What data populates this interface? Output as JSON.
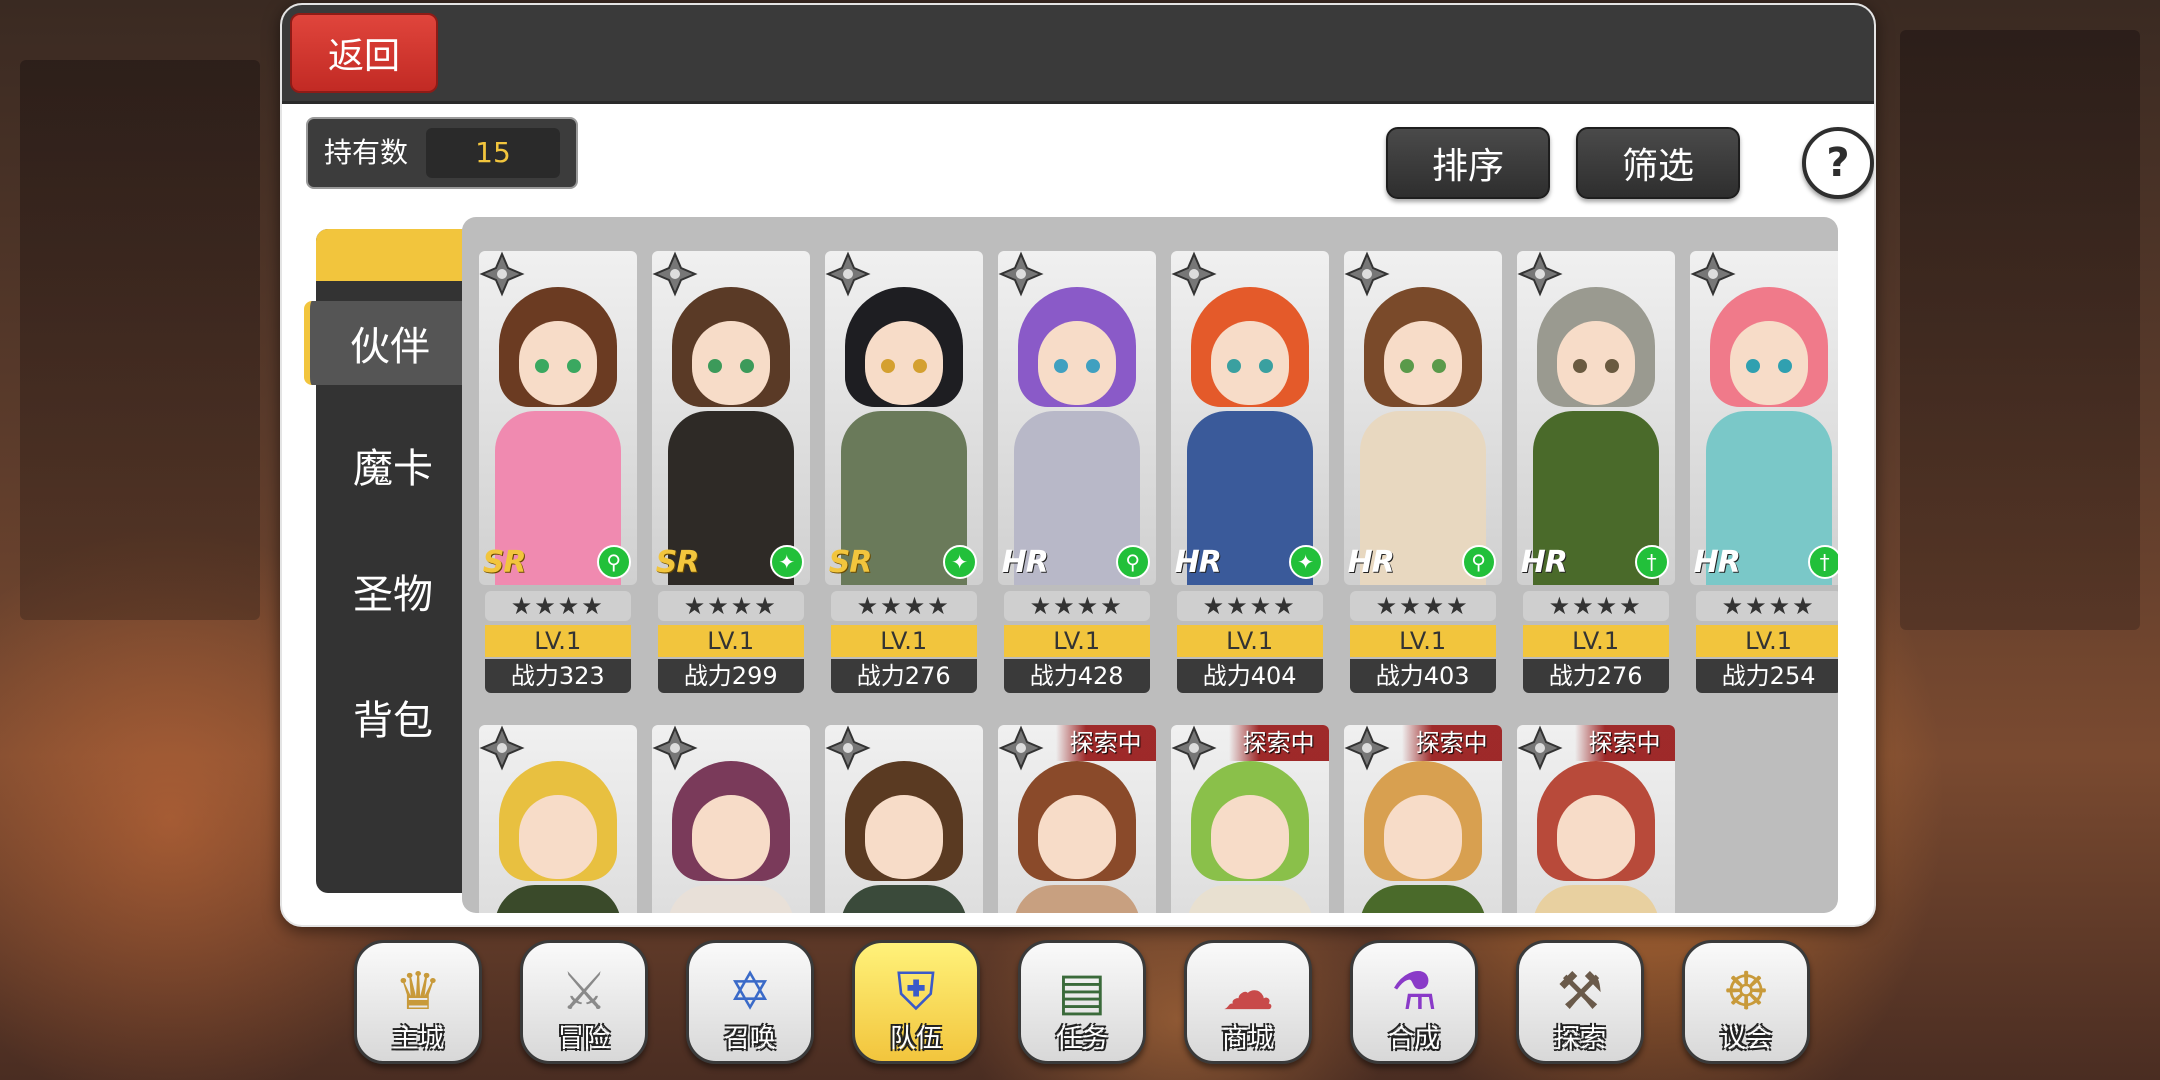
{
  "header": {
    "back_label": "返回"
  },
  "owned": {
    "label": "持有数",
    "value": "15"
  },
  "toolbar": {
    "sort_label": "排序",
    "filter_label": "筛选",
    "help_label": "?"
  },
  "sidebar": {
    "tabs": [
      {
        "label": "伙伴",
        "active": true
      },
      {
        "label": "魔卡",
        "active": false
      },
      {
        "label": "圣物",
        "active": false
      },
      {
        "label": "背包",
        "active": false
      }
    ]
  },
  "cards": [
    {
      "rarity": "SR",
      "stars": "★★★★",
      "level": "LV.1",
      "power": "战力323",
      "hair": "#6b3b22",
      "outfit": "#f08ab0",
      "eye": "#3aa860",
      "class_icon": "⚲"
    },
    {
      "rarity": "SR",
      "stars": "★★★★",
      "level": "LV.1",
      "power": "战力299",
      "hair": "#5a3a26",
      "outfit": "#2e2a26",
      "eye": "#3c9a5a",
      "class_icon": "✦"
    },
    {
      "rarity": "SR",
      "stars": "★★★★",
      "level": "LV.1",
      "power": "战力276",
      "hair": "#1e1e22",
      "outfit": "#6a7a5a",
      "eye": "#d4a030",
      "class_icon": "✦"
    },
    {
      "rarity": "HR",
      "stars": "★★★★",
      "level": "LV.1",
      "power": "战力428",
      "hair": "#8a5ac8",
      "outfit": "#b8b8c8",
      "eye": "#40a0c0",
      "class_icon": "⚲"
    },
    {
      "rarity": "HR",
      "stars": "★★★★",
      "level": "LV.1",
      "power": "战力404",
      "hair": "#e45a2a",
      "outfit": "#3a5a9a",
      "eye": "#3aa0a0",
      "class_icon": "✦"
    },
    {
      "rarity": "HR",
      "stars": "★★★★",
      "level": "LV.1",
      "power": "战力403",
      "hair": "#7a4a2a",
      "outfit": "#e8d8c0",
      "eye": "#5a9a4a",
      "class_icon": "⚲"
    },
    {
      "rarity": "HR",
      "stars": "★★★★",
      "level": "LV.1",
      "power": "战力276",
      "hair": "#9a9a90",
      "outfit": "#4a6a2a",
      "eye": "#6a5a40",
      "class_icon": "†"
    },
    {
      "rarity": "HR",
      "stars": "★★★★",
      "level": "LV.1",
      "power": "战力254",
      "hair": "#f07a8a",
      "outfit": "#7ac8c8",
      "eye": "#30a0b0",
      "class_icon": "†"
    }
  ],
  "cards_row2": [
    {
      "badge": "",
      "hair": "#e8c040",
      "outfit": "#3a4a2a"
    },
    {
      "badge": "",
      "hair": "#7a3a5a",
      "outfit": "#e8e0d8"
    },
    {
      "badge": "",
      "hair": "#5a3a22",
      "outfit": "#3a4a3a"
    },
    {
      "badge": "探索中",
      "hair": "#8a4a2a",
      "outfit": "#c8a080"
    },
    {
      "badge": "探索中",
      "hair": "#8ac04a",
      "outfit": "#e8e0d0"
    },
    {
      "badge": "探索中",
      "hair": "#d8a050",
      "outfit": "#4a6a2a"
    },
    {
      "badge": "探索中",
      "hair": "#b84a3a",
      "outfit": "#e8d0a0"
    }
  ],
  "bottom_nav": [
    {
      "label": "主城",
      "icon": "crown-icon",
      "glyph": "♛",
      "color": "#c89a3a",
      "active": false
    },
    {
      "label": "冒险",
      "icon": "crossed-swords-icon",
      "glyph": "⚔",
      "color": "#8a8a8a",
      "active": false
    },
    {
      "label": "召唤",
      "icon": "summon-card-icon",
      "glyph": "✡",
      "color": "#3a6ac8",
      "active": false
    },
    {
      "label": "队伍",
      "icon": "winged-shield-icon",
      "glyph": "⛨",
      "color": "#3a5ac8",
      "active": true
    },
    {
      "label": "任务",
      "icon": "quest-book-icon",
      "glyph": "▤",
      "color": "#3a6a3a",
      "active": false
    },
    {
      "label": "商城",
      "icon": "shop-icon",
      "glyph": "☁",
      "color": "#c84a4a",
      "active": false
    },
    {
      "label": "合成",
      "icon": "potion-icon",
      "glyph": "⚗",
      "color": "#8a3ac8",
      "active": false
    },
    {
      "label": "探索",
      "icon": "pickaxe-icon",
      "glyph": "⚒",
      "color": "#6a5a4a",
      "active": false
    },
    {
      "label": "议会",
      "icon": "council-emblem-icon",
      "glyph": "☸",
      "color": "#c89a3a",
      "active": false
    }
  ]
}
